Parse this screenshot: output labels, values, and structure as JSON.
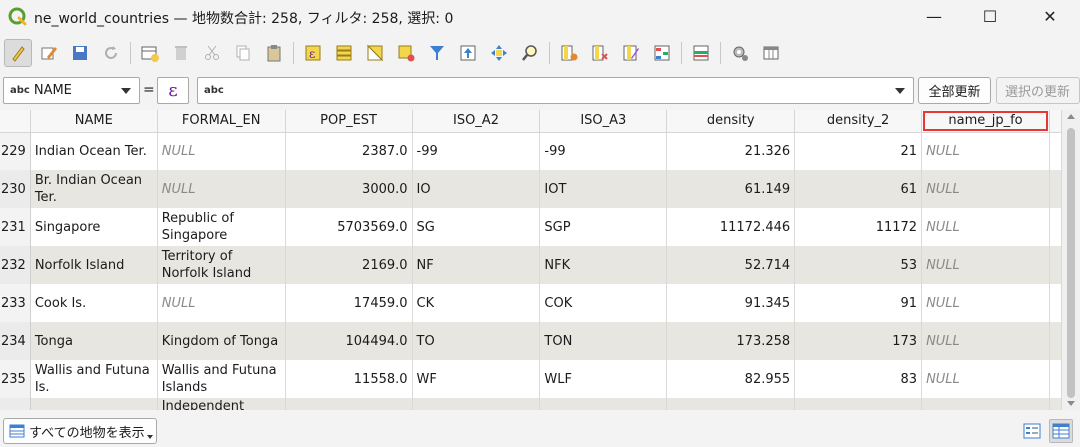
{
  "window": {
    "title": "ne_world_countries — 地物数合計: 258, フィルタ: 258, 選択: 0",
    "minimize": "—",
    "maximize": "☐",
    "close": "✕"
  },
  "toolbar": {
    "icons": [
      "toggle-editing-icon",
      "multi-edit-icon",
      "save-edits-icon",
      "reload-icon",
      "add-feature-icon",
      "delete-feature-icon",
      "cut-icon",
      "copy-icon",
      "paste-icon",
      "expression-select-icon",
      "select-all-icon",
      "invert-selection-icon",
      "deselect-icon",
      "filter-icon",
      "move-selection-top-icon",
      "pan-to-selection-icon",
      "zoom-to-selection-icon",
      "new-field-icon",
      "delete-field-icon",
      "field-calculator-icon",
      "conditional-formatting-icon",
      "dock-icon",
      "actions-icon",
      "organize-columns-icon"
    ]
  },
  "expression_bar": {
    "field_type": "abc",
    "field_name": "NAME",
    "equals": "=",
    "epsilon": "ε",
    "value_type": "abc",
    "value": "",
    "update_all": "全部更新",
    "update_selected": "選択の更新"
  },
  "table": {
    "columns": [
      "NAME",
      "FORMAL_EN",
      "POP_EST",
      "ISO_A2",
      "ISO_A3",
      "density",
      "density_2",
      "name_jp_fo"
    ],
    "highlighted_column": "name_jp_fo",
    "rows": [
      {
        "id": "229",
        "NAME": "Indian Ocean Ter.",
        "FORMAL_EN": "NULL",
        "POP_EST": "2387.0",
        "ISO_A2": "-99",
        "ISO_A3": "-99",
        "density": "21.326",
        "density_2": "21",
        "name_jp_fo": "NULL"
      },
      {
        "id": "230",
        "NAME": "Br. Indian Ocean Ter.",
        "FORMAL_EN": "NULL",
        "POP_EST": "3000.0",
        "ISO_A2": "IO",
        "ISO_A3": "IOT",
        "density": "61.149",
        "density_2": "61",
        "name_jp_fo": "NULL"
      },
      {
        "id": "231",
        "NAME": "Singapore",
        "FORMAL_EN": "Republic of Singapore",
        "POP_EST": "5703569.0",
        "ISO_A2": "SG",
        "ISO_A3": "SGP",
        "density": "11172.446",
        "density_2": "11172",
        "name_jp_fo": "NULL"
      },
      {
        "id": "232",
        "NAME": "Norfolk Island",
        "FORMAL_EN": "Territory of Norfolk Island",
        "POP_EST": "2169.0",
        "ISO_A2": "NF",
        "ISO_A3": "NFK",
        "density": "52.714",
        "density_2": "53",
        "name_jp_fo": "NULL"
      },
      {
        "id": "233",
        "NAME": "Cook Is.",
        "FORMAL_EN": "NULL",
        "POP_EST": "17459.0",
        "ISO_A2": "CK",
        "ISO_A3": "COK",
        "density": "91.345",
        "density_2": "91",
        "name_jp_fo": "NULL"
      },
      {
        "id": "234",
        "NAME": "Tonga",
        "FORMAL_EN": "Kingdom of Tonga",
        "POP_EST": "104494.0",
        "ISO_A2": "TO",
        "ISO_A3": "TON",
        "density": "173.258",
        "density_2": "173",
        "name_jp_fo": "NULL"
      },
      {
        "id": "235",
        "NAME": "Wallis and Futuna Is.",
        "FORMAL_EN": "Wallis and Futuna Islands",
        "POP_EST": "11558.0",
        "ISO_A2": "WF",
        "ISO_A3": "WLF",
        "density": "82.955",
        "density_2": "83",
        "name_jp_fo": "NULL"
      },
      {
        "id": "",
        "NAME": "",
        "FORMAL_EN": "Independent State",
        "POP_EST": "",
        "ISO_A2": "",
        "ISO_A3": "",
        "density": "",
        "density_2": "",
        "name_jp_fo": ""
      }
    ]
  },
  "bottom_bar": {
    "show_all": "すべての地物を表示"
  },
  "colors": {
    "highlight_border": "#e53935",
    "null_text": "#8a8a8a",
    "alt_row": "#e7e6e1"
  }
}
